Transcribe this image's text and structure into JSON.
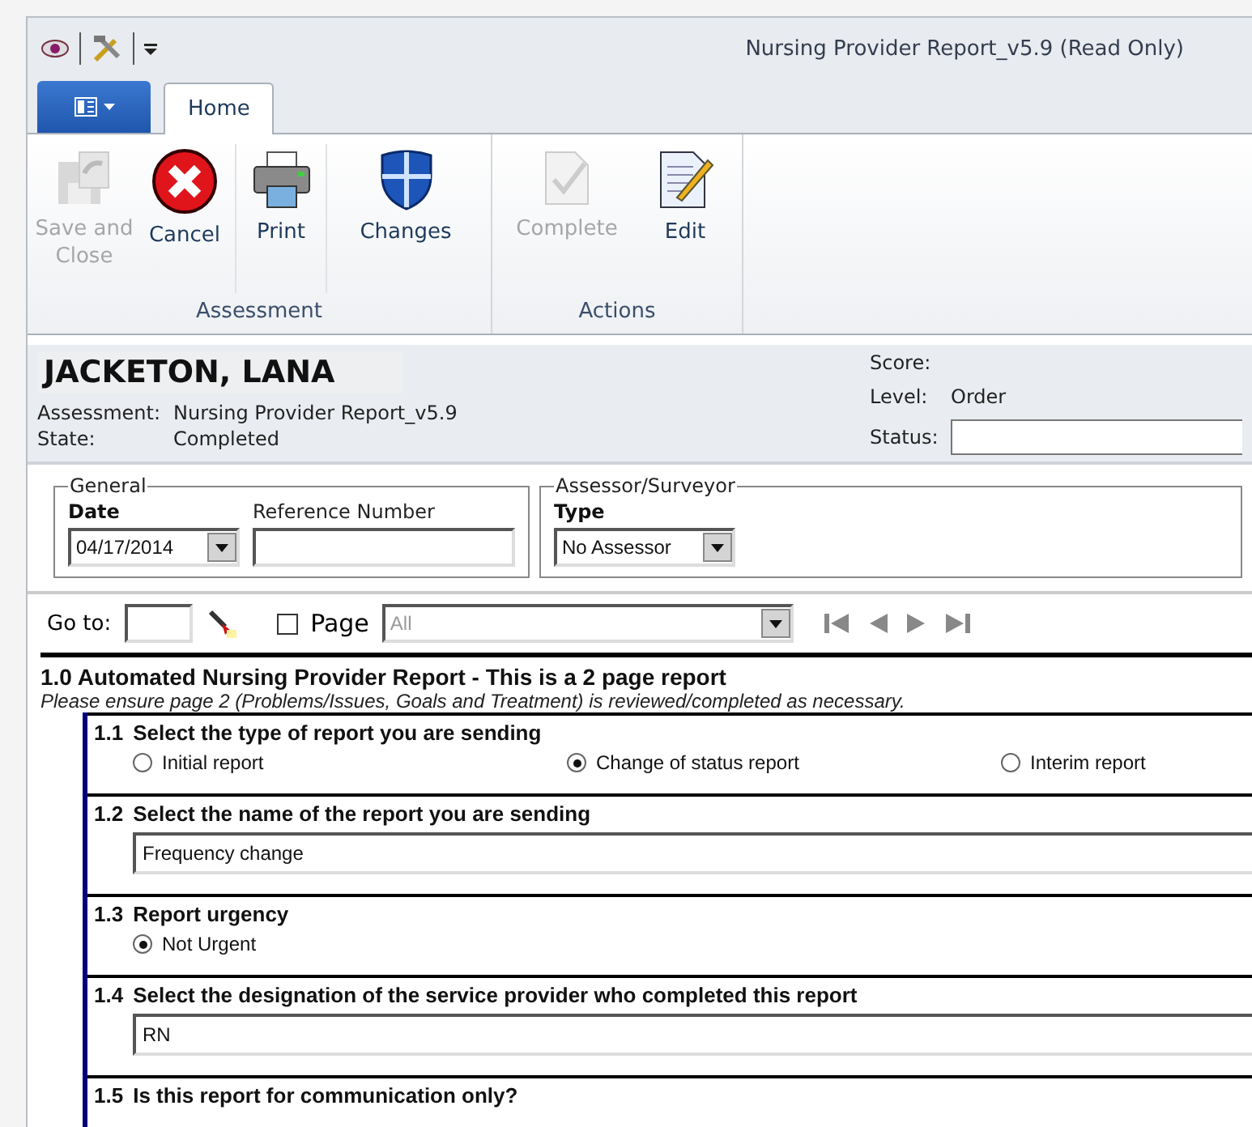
{
  "window": {
    "title": "Nursing Provider Report_v5.9 (Read Only)"
  },
  "tabs": [
    {
      "label": "Home",
      "selected": true
    }
  ],
  "ribbon": [
    {
      "label": "Assessment",
      "buttons": [
        {
          "label": "Save and Close",
          "kind": "save",
          "disabled": true
        },
        {
          "label": "Cancel",
          "kind": "cancel",
          "disabled": false
        },
        {
          "label": "Print",
          "kind": "print",
          "disabled": false,
          "separated": true
        },
        {
          "label": "Changes",
          "kind": "shield",
          "disabled": false,
          "separated": true
        }
      ]
    },
    {
      "label": "Actions",
      "buttons": [
        {
          "label": "Complete",
          "kind": "complete",
          "disabled": true
        },
        {
          "label": "Edit",
          "kind": "edit",
          "disabled": false
        }
      ]
    }
  ],
  "header": {
    "name": "JACKETON, LANA",
    "fields": [
      {
        "label": "Assessment:",
        "value": "Nursing Provider Report_v5.9"
      },
      {
        "label": "State:",
        "value": "Completed"
      }
    ],
    "score_label": "Score:",
    "level_label": "Level:",
    "level_value": "Order",
    "status_label": "Status:"
  },
  "general": {
    "legend": "General",
    "date_label": "Date",
    "date_value": "04/17/2014",
    "reference_label": "Reference Number"
  },
  "assessor": {
    "legend": "Assessor/Surveyor",
    "type_label": "Type",
    "type_value": "No Assessor"
  },
  "navigator": {
    "goto_label": "Go to:",
    "page_label": "Page",
    "page_checked": false,
    "page_value": "All"
  },
  "section": {
    "title": "1.0 Automated Nursing Provider Report - This is a 2 page report",
    "note": "Please ensure page 2 (Problems/Issues, Goals and Treatment) is reviewed/completed as necessary.",
    "questions": [
      {
        "number": "1.1",
        "text": "Select the type of report you are sending",
        "kind": "radio",
        "options": [
          {
            "label": "Initial report",
            "selected": false
          },
          {
            "label": "Change of status report",
            "selected": true
          },
          {
            "label": "Interim report",
            "selected": false
          }
        ]
      },
      {
        "number": "1.2",
        "text": "Select the name of the report you are sending",
        "kind": "text",
        "value": "Frequency change"
      },
      {
        "number": "1.3",
        "text": "Report urgency",
        "kind": "radio",
        "options": [
          {
            "label": "Not Urgent",
            "selected": true
          }
        ]
      },
      {
        "number": "1.4",
        "text": "Select the designation of the service provider who completed this report",
        "kind": "text",
        "value": "RN"
      },
      {
        "number": "1.5",
        "text": "Is this report for communication only?",
        "kind": "none"
      }
    ]
  }
}
